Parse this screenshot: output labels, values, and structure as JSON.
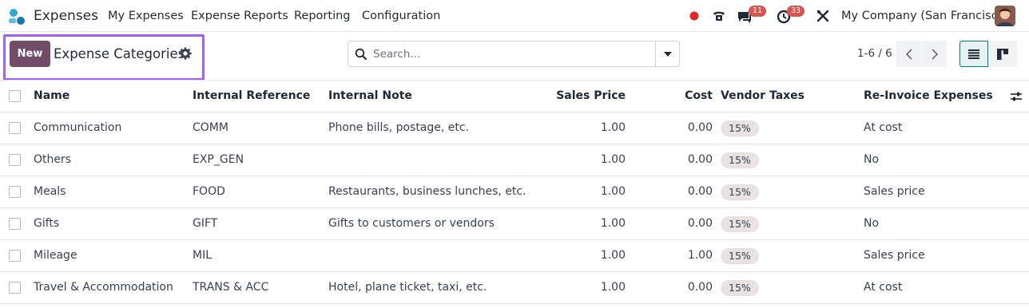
{
  "navbar": {
    "app_name": "Expenses",
    "menu": [
      "My Expenses",
      "Expense Reports",
      "Reporting",
      "Configuration"
    ],
    "messages_badge": "11",
    "activities_badge": "33",
    "company": "My Company (San Francisco)"
  },
  "control": {
    "new_label": "New",
    "breadcrumb": "Expense Categories",
    "search_placeholder": "Search...",
    "pager": "1-6 / 6"
  },
  "table": {
    "headers": {
      "name": "Name",
      "ref": "Internal Reference",
      "note": "Internal Note",
      "price": "Sales Price",
      "cost": "Cost",
      "vtax": "Vendor Taxes",
      "reinv": "Re-Invoice Expenses"
    },
    "rows": [
      {
        "name": "Communication",
        "ref": "COMM",
        "note": "Phone bills, postage, etc.",
        "price": "1.00",
        "cost": "0.00",
        "tax": "15%",
        "reinv": "At cost"
      },
      {
        "name": "Others",
        "ref": "EXP_GEN",
        "note": "",
        "price": "1.00",
        "cost": "0.00",
        "tax": "15%",
        "reinv": "No"
      },
      {
        "name": "Meals",
        "ref": "FOOD",
        "note": "Restaurants, business lunches, etc.",
        "price": "1.00",
        "cost": "0.00",
        "tax": "15%",
        "reinv": "Sales price"
      },
      {
        "name": "Gifts",
        "ref": "GIFT",
        "note": "Gifts to customers or vendors",
        "price": "1.00",
        "cost": "0.00",
        "tax": "15%",
        "reinv": "No"
      },
      {
        "name": "Mileage",
        "ref": "MIL",
        "note": "",
        "price": "1.00",
        "cost": "1.00",
        "tax": "15%",
        "reinv": "Sales price"
      },
      {
        "name": "Travel & Accommodation",
        "ref": "TRANS & ACC",
        "note": "Hotel, plane ticket, taxi, etc.",
        "price": "1.00",
        "cost": "0.00",
        "tax": "15%",
        "reinv": "At cost"
      }
    ]
  },
  "colors": {
    "brand": "#714b67",
    "highlight": "#a461ee",
    "badge": "#d9534f",
    "tag_bg": "#e8e2e2",
    "active_view": "#017e84"
  },
  "icons": [
    "expenses-app-icon",
    "record-dot-icon",
    "phone-icon",
    "chat-icon",
    "clock-icon",
    "tools-icon",
    "gear-icon",
    "search-icon",
    "caret-down-icon",
    "chevron-left-icon",
    "chevron-right-icon",
    "list-view-icon",
    "kanban-view-icon",
    "optional-columns-icon"
  ]
}
